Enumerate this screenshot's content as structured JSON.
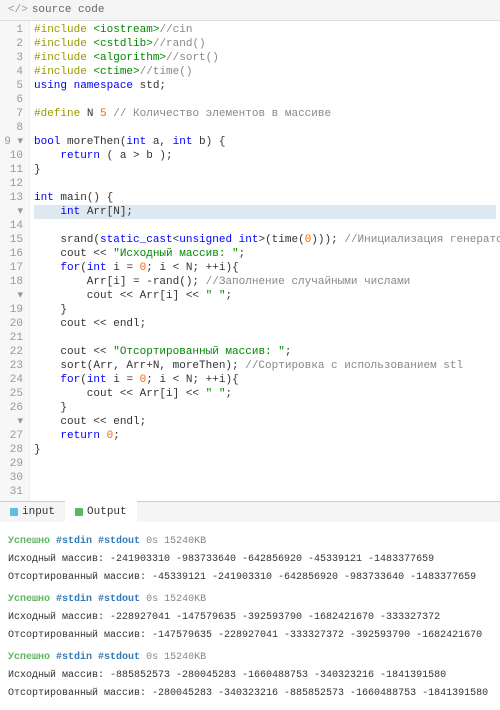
{
  "header": {
    "icon": "</>",
    "title": "source code"
  },
  "code": {
    "lines": [
      {
        "n": 1,
        "html": "<span class='pp'>#include</span> <span class='str'>&lt;iostream&gt;</span><span class='cmt'>//cin</span>"
      },
      {
        "n": 2,
        "html": "<span class='pp'>#include</span> <span class='str'>&lt;cstdlib&gt;</span><span class='cmt'>//rand()</span>"
      },
      {
        "n": 3,
        "html": "<span class='pp'>#include</span> <span class='str'>&lt;algorithm&gt;</span><span class='cmt'>//sort()</span>"
      },
      {
        "n": 4,
        "html": "<span class='pp'>#include</span> <span class='str'>&lt;ctime&gt;</span><span class='cmt'>//time()</span>"
      },
      {
        "n": 5,
        "html": "<span class='kw'>using namespace</span> std;"
      },
      {
        "n": 6,
        "html": ""
      },
      {
        "n": 7,
        "html": "<span class='pp'>#define</span> N <span class='num'>5</span> <span class='cmt'>// Количество элементов в массиве</span>"
      },
      {
        "n": 8,
        "html": ""
      },
      {
        "n": "9 ▾",
        "html": "<span class='type'>bool</span> moreThen(<span class='type'>int</span> a, <span class='type'>int</span> b) {"
      },
      {
        "n": 10,
        "html": "    <span class='kw'>return</span> ( a > b );"
      },
      {
        "n": 11,
        "html": "}"
      },
      {
        "n": 12,
        "html": ""
      },
      {
        "n": "13 ▾",
        "html": "<span class='type'>int</span> main() {"
      },
      {
        "n": 14,
        "html": "    <span class='type'>int</span> Arr[N];",
        "hl": true
      },
      {
        "n": 15,
        "html": ""
      },
      {
        "n": 16,
        "html": "    srand(<span class='kw'>static_cast</span>&lt;<span class='type'>unsigned int</span>&gt;(time(<span class='num'>0</span>))); <span class='cmt'>//Инициализация генератора случайных чисел</span>"
      },
      {
        "n": 17,
        "html": "    cout &lt;&lt; <span class='str'>\"Исходный массив: \"</span>;"
      },
      {
        "n": "18 ▾",
        "html": "    <span class='kw'>for</span>(<span class='type'>int</span> i = <span class='num'>0</span>; i &lt; N; ++i){"
      },
      {
        "n": 19,
        "html": "        Arr[i] = -rand(); <span class='cmt'>//Заполнение случайными числами</span>"
      },
      {
        "n": 20,
        "html": "        cout &lt;&lt; Arr[i] &lt;&lt; <span class='str'>\" \"</span>;"
      },
      {
        "n": 21,
        "html": "    }"
      },
      {
        "n": 22,
        "html": "    cout &lt;&lt; endl;"
      },
      {
        "n": 23,
        "html": ""
      },
      {
        "n": 24,
        "html": "    cout &lt;&lt; <span class='str'>\"Отсортированный массив: \"</span>;"
      },
      {
        "n": 25,
        "html": "    sort(Arr, Arr+N, moreThen); <span class='cmt'>//Сортировка с использованием stl</span>"
      },
      {
        "n": "26 ▾",
        "html": "    <span class='kw'>for</span>(<span class='type'>int</span> i = <span class='num'>0</span>; i &lt; N; ++i){"
      },
      {
        "n": 27,
        "html": "        cout &lt;&lt; Arr[i] &lt;&lt; <span class='str'>\" \"</span>;"
      },
      {
        "n": 28,
        "html": "    }"
      },
      {
        "n": 29,
        "html": "    cout &lt;&lt; endl;"
      },
      {
        "n": 30,
        "html": "    <span class='kw'>return</span> <span class='num'>0</span>;"
      },
      {
        "n": 31,
        "html": "}"
      }
    ]
  },
  "tabs": {
    "input": "input",
    "output": "Output"
  },
  "runs": [
    {
      "status": "Успешно",
      "stdin": "#stdin",
      "stdout": "#stdout",
      "time": "0s",
      "mem": "15240KB",
      "line1": "Исходный массив: -241903310 -983733640 -642856920 -45339121 -1483377659",
      "line2": "Отсортированный массив: -45339121 -241903310 -642856920 -983733640 -1483377659"
    },
    {
      "status": "Успешно",
      "stdin": "#stdin",
      "stdout": "#stdout",
      "time": "0s",
      "mem": "15240KB",
      "line1": "Исходный массив: -228927041 -147579635 -392593790 -1682421670 -333327372",
      "line2": "Отсортированный массив: -147579635 -228927041 -333327372 -392593790 -1682421670"
    },
    {
      "status": "Успешно",
      "stdin": "#stdin",
      "stdout": "#stdout",
      "time": "0s",
      "mem": "15240KB",
      "line1": "Исходный массив: -885852573 -280045283 -1660488753 -340323216 -1841391580",
      "line2": "Отсортированный массив: -280045283 -340323216 -885852573 -1660488753 -1841391580"
    }
  ]
}
